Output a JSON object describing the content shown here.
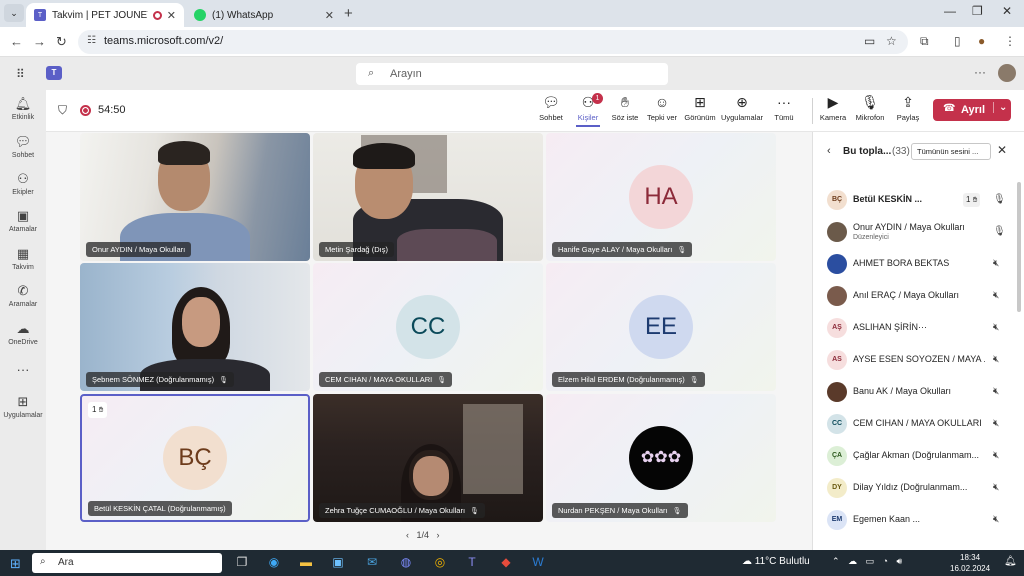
{
  "browser": {
    "tabs": [
      {
        "title": "Takvim | PET JOUNEY PROJ",
        "active": true
      },
      {
        "title": "(1) WhatsApp",
        "active": false
      }
    ],
    "url": "teams.microsoft.com/v2/"
  },
  "teams": {
    "search_placeholder": "Arayın",
    "rail": [
      {
        "icon": "bell-icon",
        "label": "Etkinlik"
      },
      {
        "icon": "chat-icon",
        "label": "Sohbet"
      },
      {
        "icon": "teams-icon",
        "label": "Ekipler"
      },
      {
        "icon": "backpack-icon",
        "label": "Atamalar"
      },
      {
        "icon": "calendar-icon",
        "label": "Takvim"
      },
      {
        "icon": "phone-icon",
        "label": "Aramalar"
      },
      {
        "icon": "onedrive-icon",
        "label": "OneDrive"
      },
      {
        "icon": "more-icon",
        "label": ""
      },
      {
        "icon": "apps-plus-icon",
        "label": "Uygulamalar"
      }
    ]
  },
  "meeting": {
    "timer": "54:50",
    "controls": [
      {
        "id": "chat",
        "label": "Sohbet",
        "icon": "chat-icon"
      },
      {
        "id": "people",
        "label": "Kişiler",
        "icon": "people-icon",
        "badge": "1",
        "active": true
      },
      {
        "id": "raise",
        "label": "Söz iste",
        "icon": "hand-icon"
      },
      {
        "id": "react",
        "label": "Tepki ver",
        "icon": "smile-icon"
      },
      {
        "id": "view",
        "label": "Görünüm",
        "icon": "grid-icon"
      },
      {
        "id": "apps",
        "label": "Uygulamalar",
        "icon": "plus-icon"
      },
      {
        "id": "more",
        "label": "Tümü",
        "icon": "more-icon"
      },
      {
        "id": "camera",
        "label": "Kamera",
        "icon": "camera-icon"
      },
      {
        "id": "mic",
        "label": "Mikrofon",
        "icon": "mic-icon"
      },
      {
        "id": "share",
        "label": "Paylaş",
        "icon": "share-icon"
      }
    ],
    "leave_label": "Ayrıl",
    "tiles": [
      {
        "name": "Onur AYDIN / Maya Okulları",
        "type": "video",
        "muted": false
      },
      {
        "name": "Metin Şardağ (Dış)",
        "type": "video",
        "muted": false
      },
      {
        "name": "Hanife Gaye ALAY / Maya Okulları",
        "type": "avatar",
        "initials": "HA",
        "muted": true
      },
      {
        "name": "Şebnem SÖNMEZ (Doğrulanmamış)",
        "type": "video",
        "muted": true
      },
      {
        "name": "CEM CIHAN / MAYA OKULLARI",
        "type": "avatar",
        "initials": "CC",
        "muted": true
      },
      {
        "name": "Elzem Hilal ERDEM (Doğrulanmamış)",
        "type": "avatar",
        "initials": "EE",
        "muted": true
      },
      {
        "name": "Betül KESKİN ÇATAL (Doğrulanmamış)",
        "type": "avatar",
        "initials": "BÇ",
        "muted": false,
        "hand": "1",
        "selected": true
      },
      {
        "name": "Zehra Tuğçe CUMAOĞLU / Maya Okulları",
        "type": "video",
        "muted": true
      },
      {
        "name": "Nurdan PEKŞEN / Maya Okulları",
        "type": "flower",
        "muted": true
      }
    ],
    "pager": "1/4"
  },
  "participants": {
    "title": "Bu topla...",
    "count": "(33)",
    "mute_all_label": "Tümünün sesini ...",
    "list": [
      {
        "initials": "BÇ",
        "name": "Betül KESKİN ...",
        "hand": "1",
        "muted": false,
        "bold": true
      },
      {
        "initials": "",
        "name": "Onur AYDIN / Maya Okulları",
        "sub": "Düzenleyici",
        "muted": false
      },
      {
        "initials": "",
        "name": "AHMET BORA BEKTAS",
        "muted": true
      },
      {
        "initials": "",
        "name": "Anıl ERAÇ / Maya Okulları",
        "muted": true
      },
      {
        "initials": "AŞ",
        "name": "ASLIHAN ŞİRİN···",
        "muted": true
      },
      {
        "initials": "AS",
        "name": "AYSE ESEN SOYOZEN / MAYA ...",
        "muted": true
      },
      {
        "initials": "",
        "name": "Banu AK / Maya Okulları",
        "muted": true
      },
      {
        "initials": "CC",
        "name": "CEM CIHAN / MAYA OKULLARI",
        "muted": true
      },
      {
        "initials": "ÇA",
        "name": "Çağlar Akman (Doğrulanmam...",
        "muted": true
      },
      {
        "initials": "DY",
        "name": "Dilay Yıldız (Doğrulanmam...",
        "muted": true
      },
      {
        "initials": "EM",
        "name": "Egemen Kaan ...",
        "muted": true
      }
    ]
  },
  "taskbar": {
    "search_placeholder": "Ara",
    "weather": "11°C  Bulutlu",
    "time": "18:34",
    "date": "16.02.2024"
  }
}
